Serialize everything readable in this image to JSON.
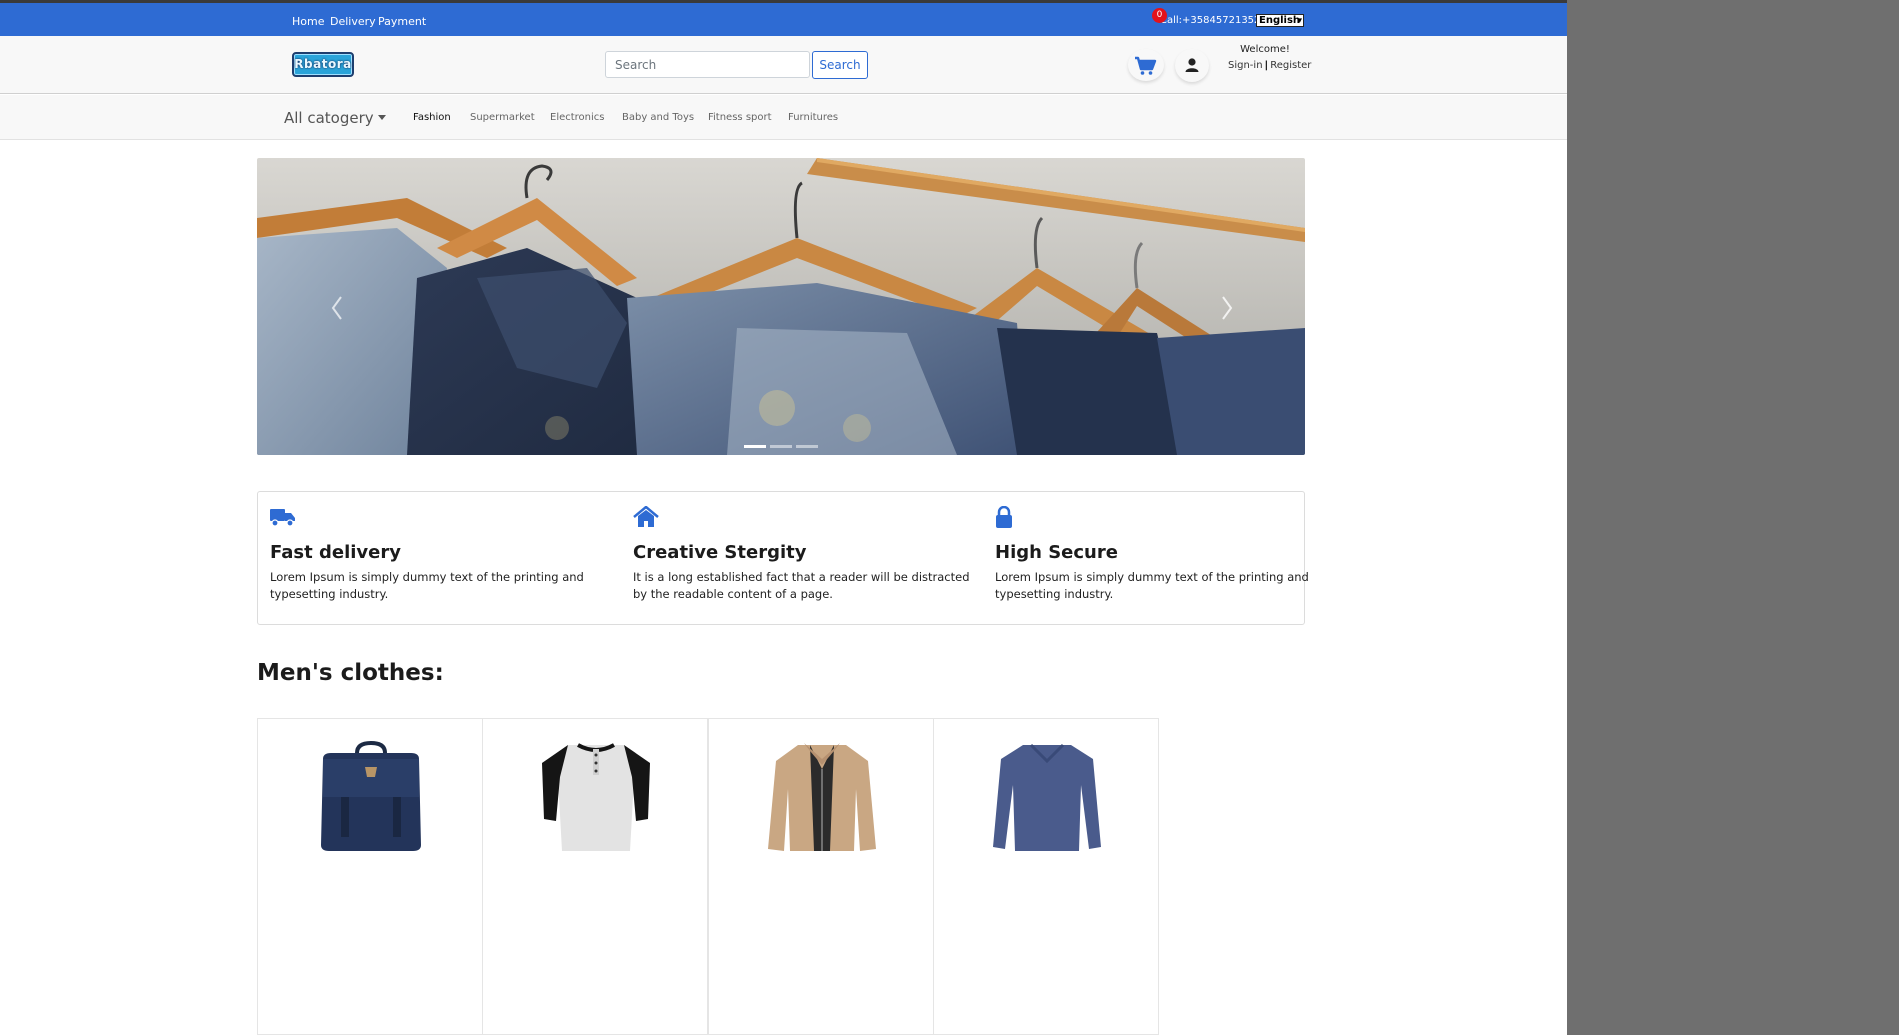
{
  "topbar": {
    "links": [
      "Home",
      "Delivery",
      "Payment"
    ],
    "phone": "Call:+35845721352",
    "language": "English"
  },
  "header": {
    "logo_text": "Rbatora",
    "search_placeholder": "Search",
    "search_button": "Search",
    "cart_count": "0",
    "welcome": "Welcome!",
    "sign_in": "Sign-in",
    "register": "Register"
  },
  "categories": {
    "all_label": "All catogery",
    "items": [
      "Fashion",
      "Supermarket",
      "Electronics",
      "Baby and Toys",
      "Fitness sport",
      "Furnitures"
    ]
  },
  "features": [
    {
      "icon": "truck-icon",
      "title": "Fast delivery",
      "text": "Lorem Ipsum is simply dummy text of the printing and typesetting industry."
    },
    {
      "icon": "home-icon",
      "title": "Creative Stergity",
      "text": "It is a long established fact that a reader will be distracted by the readable content of a page."
    },
    {
      "icon": "lock-icon",
      "title": "High Secure",
      "text": "Lorem Ipsum is simply dummy text of the printing and typesetting industry."
    }
  ],
  "section_title": "Men's clothes:",
  "products": [
    {
      "icon": "backpack-image"
    },
    {
      "icon": "henley-shirt-image"
    },
    {
      "icon": "jacket-image"
    },
    {
      "icon": "longsleeve-shirt-image"
    }
  ],
  "colors": {
    "primary": "#2e6bd3",
    "badge": "#e3121b"
  }
}
